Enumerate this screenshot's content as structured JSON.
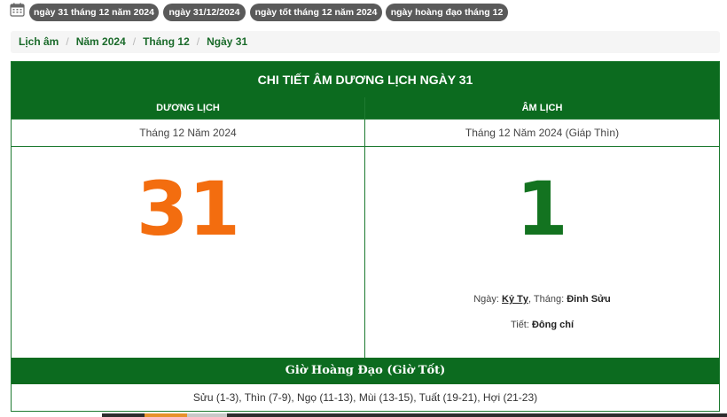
{
  "tags": [
    {
      "label": "ngày 31 tháng 12 năm 2024"
    },
    {
      "label": "ngày 31/12/2024"
    },
    {
      "label": "ngày tốt tháng 12 năm 2024"
    },
    {
      "label": "ngày hoàng đạo tháng 12"
    }
  ],
  "breadcrumb": {
    "items": [
      "Lịch âm",
      "Năm 2024",
      "Tháng 12",
      "Ngày 31"
    ],
    "separator": "/"
  },
  "panel": {
    "title": "CHI TIẾT ÂM DƯƠNG LỊCH NGÀY 31",
    "solar": {
      "header": "DƯƠNG LỊCH",
      "month": "Tháng 12 Năm 2024",
      "day": "31"
    },
    "lunar": {
      "header": "ÂM LỊCH",
      "month": "Tháng 12 Năm 2024 (Giáp Thìn)",
      "day": "1",
      "day_label": "Ngày: ",
      "day_canchi": "Kỷ Tỵ",
      "month_label": ", Tháng: ",
      "month_canchi": "Đinh Sửu",
      "tiet_label": "Tiết: ",
      "tiet_value": "Đông chí"
    },
    "hours_header": "Giờ Hoàng Đạo (Giờ Tốt)",
    "hours_list": "Sửu (1-3), Thìn (7-9), Ngọ (11-13), Mùi (13-15), Tuất (19-21), Hợi (21-23)"
  },
  "colors": {
    "green": "#0c6b1f",
    "solar_day": "#f36d0f",
    "lunar_day": "#137320",
    "tag_bg": "#5a5a5a"
  }
}
